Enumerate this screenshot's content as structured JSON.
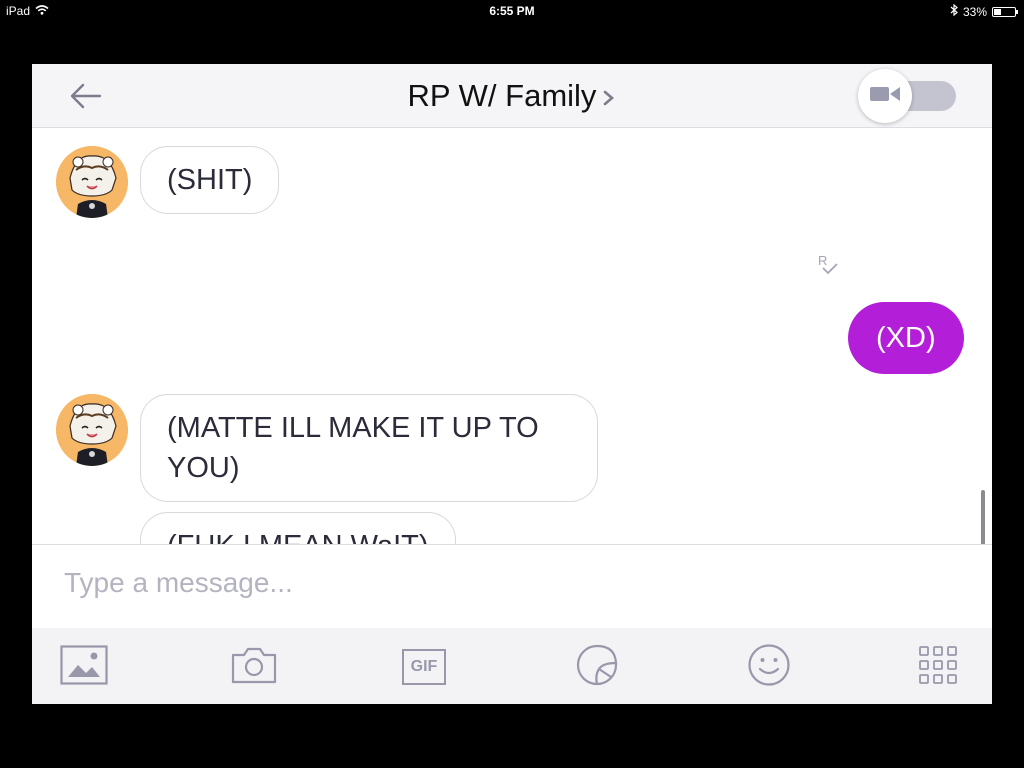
{
  "status_bar": {
    "device": "iPad",
    "time": "6:55 PM",
    "battery": "33%",
    "battery_level": 0.33
  },
  "header": {
    "title": "RP W/ Family",
    "back_icon": "arrow-left-icon",
    "title_chevron_icon": "chevron-right-icon",
    "video_toggle_icon": "video-camera-icon",
    "video_toggle_on": false
  },
  "messages": [
    {
      "direction": "incoming",
      "text": "(SHIT)",
      "avatar": "anime-avatar"
    },
    {
      "direction": "outgoing",
      "text": "(XD)",
      "read_receipt_icon": "read-receipt-icon"
    },
    {
      "direction": "incoming",
      "text": "(MATTE ILL MAKE IT UP TO YOU)",
      "avatar": "anime-avatar"
    },
    {
      "direction": "incoming",
      "text": "(FUK I MEAN WaIT)"
    }
  ],
  "composer": {
    "placeholder": "Type a message...",
    "value": ""
  },
  "toolbar": {
    "gif_label": "GIF",
    "icons": [
      "photo-icon",
      "camera-icon",
      "gif-icon",
      "sticker-icon",
      "emoji-icon",
      "apps-grid-icon"
    ]
  },
  "colors": {
    "accent": "#b31fd8",
    "header_bg": "#f5f5f8",
    "toolbar_bg": "#f3f3f6",
    "avatar_bg": "#f6b766"
  }
}
